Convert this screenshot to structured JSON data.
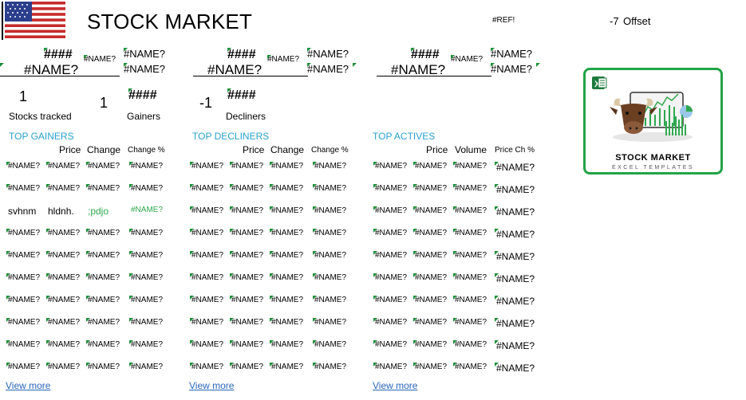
{
  "header": {
    "title": "STOCK MARKET",
    "ref_error": "#REF!",
    "offset_value": "-7",
    "offset_label": "Offset"
  },
  "indices": [
    {
      "hash": "####",
      "name_big": "#NAME?",
      "name_small": "#NAME?",
      "name_top": "#NAME?",
      "name_bottom": "#NAME?"
    },
    {
      "hash": "####",
      "name_big": "#NAME?",
      "name_small": "#NAME?",
      "name_top": "#NAME?",
      "name_bottom": "#NAME?"
    },
    {
      "hash": "####",
      "name_big": "#NAME?",
      "name_small": "#NAME?",
      "name_top": "#NAME?",
      "name_bottom": "#NAME?"
    }
  ],
  "stats": {
    "tracked_value": "1",
    "tracked_label": "Stocks tracked",
    "gainers_value": "1",
    "gainers_hash": "####",
    "gainers_label": "Gainers",
    "decliners_value": "-1",
    "decliners_hash": "####",
    "decliners_label": "Decliners"
  },
  "sections": {
    "gainers": {
      "title": "TOP GAINERS",
      "headers": [
        "Price",
        "Change",
        "Change %"
      ],
      "special_row": [
        "svhnm",
        "hldnh.",
        ";pdjo",
        "#NAME?"
      ],
      "cell": "#NAME?",
      "link": "View more"
    },
    "decliners": {
      "title": "TOP DECLINERS",
      "headers": [
        "Price",
        "Change",
        "Change %"
      ],
      "cell": "#NAME?",
      "link": "View more"
    },
    "actives": {
      "title": "TOP ACTIVES",
      "headers": [
        "Price",
        "Volume",
        "Price Ch %"
      ],
      "cell": "#NAME?",
      "link": "View more"
    }
  },
  "logo": {
    "title": "STOCK MARKET",
    "subtitle": "EXCEL TEMPLATES"
  },
  "colors": {
    "accent_green": "#22a447",
    "section_blue": "#2aa0d0",
    "link_blue": "#2a66b8"
  }
}
